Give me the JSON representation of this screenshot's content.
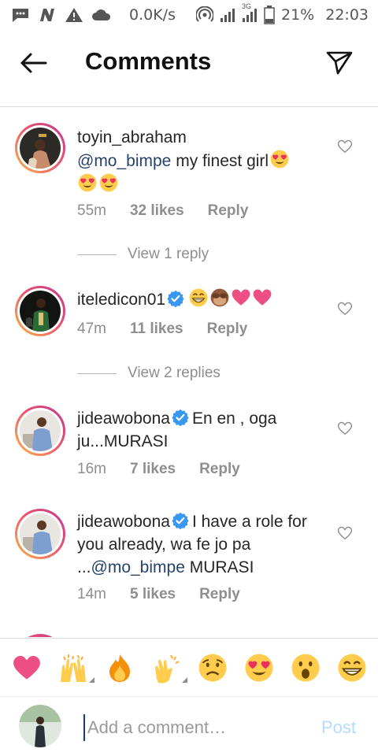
{
  "status_bar": {
    "speed": "0.0K/s",
    "network_label": "3G",
    "battery": "21%",
    "time": "22:03",
    "icons": [
      "message-icon",
      "n-icon",
      "warning-icon",
      "cloud-icon",
      "hotspot-icon",
      "signal-icon",
      "battery-icon"
    ]
  },
  "header": {
    "title": "Comments",
    "back_icon": "back-arrow-icon",
    "share_icon": "direct-share-icon"
  },
  "comments": [
    {
      "username": "toyin_abraham",
      "verified": false,
      "mention": "@mo_bimpe",
      "text": " my finest girl",
      "emojis": [
        "heart-eyes",
        "heart-eyes",
        "heart-eyes"
      ],
      "time": "55m",
      "likes": "32 likes",
      "reply_label": "Reply"
    },
    {
      "username": "iteledicon01",
      "verified": true,
      "text": "",
      "emojis": [
        "grin-sweat",
        "see-no-evil",
        "heart",
        "heart"
      ],
      "time": "47m",
      "likes": "11 likes",
      "reply_label": "Reply"
    },
    {
      "username": "jideawobona",
      "verified": true,
      "text": "En en , oga ju...MURASI",
      "time": "16m",
      "likes": "7 likes",
      "reply_label": "Reply"
    },
    {
      "username": "jideawobona",
      "verified": true,
      "text_before": "I have a role for you already, wa fe jo pa ...",
      "mention": "@mo_bimpe",
      "text_after": " MURASI",
      "time": "14m",
      "likes": "5 likes",
      "reply_label": "Reply"
    }
  ],
  "view_replies": [
    "View 1 reply",
    "View 2 replies"
  ],
  "emoji_bar": [
    "heart",
    "raised-hands",
    "fire",
    "clap",
    "disappointed",
    "heart-eyes",
    "open-mouth",
    "grin"
  ],
  "compose": {
    "placeholder": "Add a comment…",
    "value": "",
    "post_label": "Post"
  },
  "colors": {
    "mention": "#27426b",
    "muted": "#8e8e8e",
    "post_disabled": "#b3dbff",
    "verified": "#3897f0",
    "heart": "#ed4f84"
  }
}
